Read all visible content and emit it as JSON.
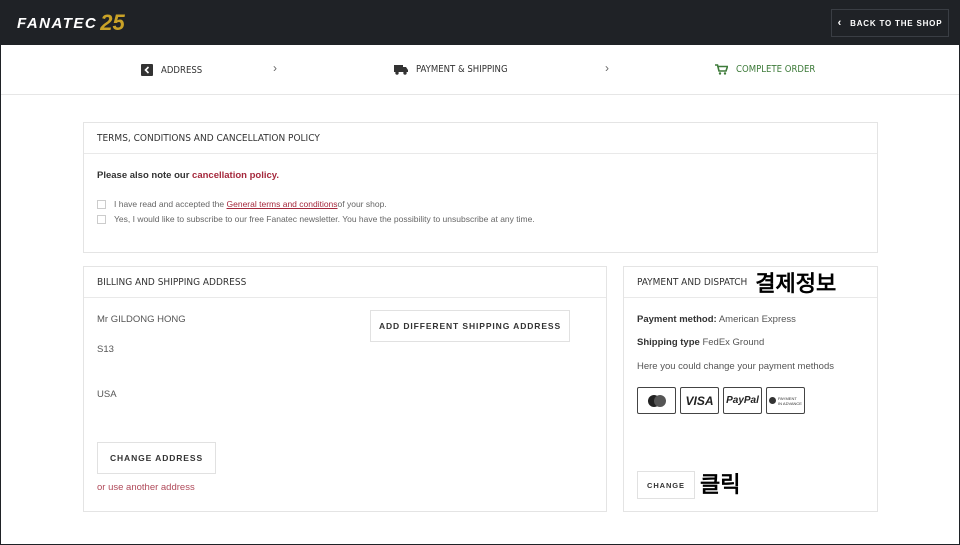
{
  "header": {
    "logo_text": "FANATEC",
    "logo_mark": "25",
    "back_button": "BACK TO THE SHOP"
  },
  "steps": [
    {
      "label": "ADDRESS",
      "icon": "arrow-back-icon"
    },
    {
      "label": "PAYMENT & SHIPPING",
      "icon": "truck-icon"
    },
    {
      "label": "COMPLETE ORDER",
      "icon": "cart-icon"
    }
  ],
  "terms": {
    "title": "TERMS, CONDITIONS AND CANCELLATION POLICY",
    "note_prefix": "Please also note our ",
    "note_link": "cancellation policy.",
    "check1_prefix": "I have read and accepted the ",
    "check1_link": "General terms and conditions",
    "check1_suffix": " of your shop.",
    "check2": "Yes, I would like to subscribe to our free Fanatec newsletter. You have the possibility to unsubscribe at any time."
  },
  "billing": {
    "title": "BILLING AND SHIPPING ADDRESS",
    "name": "Mr GILDONG HONG",
    "line1": "S13",
    "country": "USA",
    "add_shipping_button": "ADD DIFFERENT SHIPPING ADDRESS",
    "change_address_button": "CHANGE ADDRESS",
    "other_address_link": "or use another address"
  },
  "payment": {
    "title": "PAYMENT AND DISPATCH",
    "title_annotation": "결제정보",
    "method_label": "Payment method:",
    "method_value": " American Express",
    "shipping_label": "Shipping type",
    "shipping_value": " FedEx Ground",
    "change_hint": "Here you could change your payment methods",
    "icons": {
      "visa": "VISA",
      "paypal": "PayPal",
      "pia_line1": "PAYMENT",
      "pia_line2": "IN ADVANCE"
    },
    "change_button": "CHANGE",
    "change_annotation": "클릭"
  },
  "colors": {
    "header_bg": "#1f2226",
    "accent_red": "#a5283c",
    "active_step": "#3e7b3a",
    "logo_gold": "#c9a227"
  }
}
